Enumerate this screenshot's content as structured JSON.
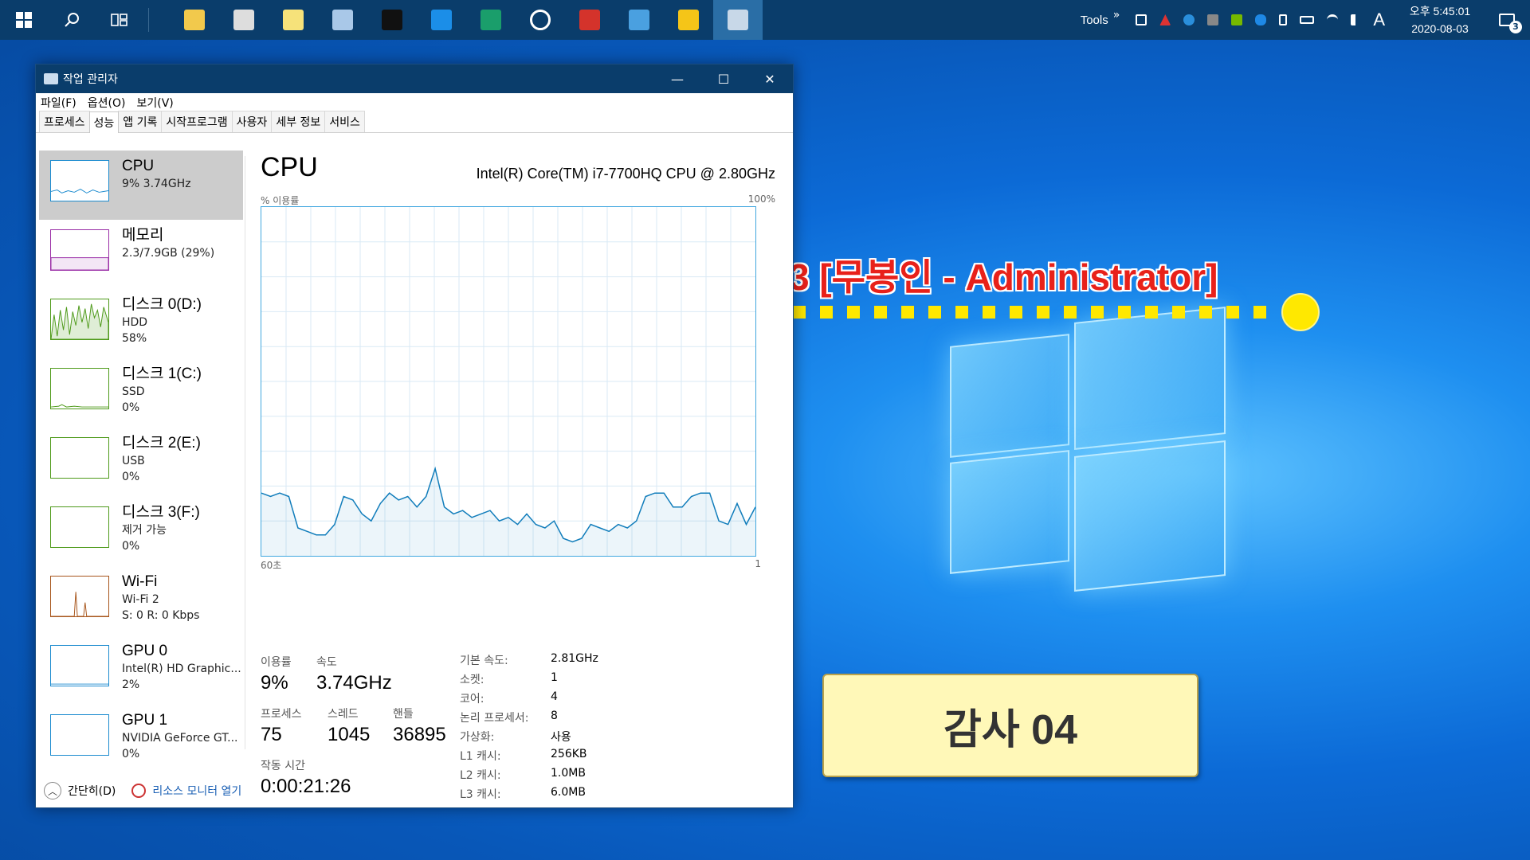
{
  "taskbar": {
    "start_icon": "windows-logo-icon",
    "search_icon": "search-icon",
    "taskview_icon": "task-view-icon",
    "apps": [
      {
        "name": "file-explorer",
        "color": "#f2c94c"
      },
      {
        "name": "calculator",
        "color": "#dddddd"
      },
      {
        "name": "sticky-notes",
        "color": "#f6e27a"
      },
      {
        "name": "app-blue-glass",
        "color": "#a9c8e8"
      },
      {
        "name": "command-prompt",
        "color": "#111111"
      },
      {
        "name": "internet-explorer",
        "color": "#1b8ee8"
      },
      {
        "name": "edge-dev",
        "color": "#1a9e6b"
      },
      {
        "name": "settings",
        "color": "#ffffff"
      },
      {
        "name": "red-green-app",
        "color": "#d4332b"
      },
      {
        "name": "control-panel",
        "color": "#4aa0e0"
      },
      {
        "name": "potplayer",
        "color": "#f5c518"
      },
      {
        "name": "task-manager",
        "color": "#c8d8e8"
      }
    ],
    "tools_label": "Tools",
    "overflow": "»",
    "ime": "A",
    "time": "오후 5:45:01",
    "date": "2020-08-03",
    "notification_count": "3"
  },
  "desktop": {
    "banner": "3 [무봉인  - Administrator]",
    "sticky_note": "감사 04"
  },
  "window": {
    "title": "작업 관리자",
    "minimize": "—",
    "maximize": "☐",
    "close": "✕"
  },
  "menu": [
    "파일(F)",
    "옵션(O)",
    "보기(V)"
  ],
  "tabs": [
    "프로세스",
    "성능",
    "앱 기록",
    "시작프로그램",
    "사용자",
    "세부 정보",
    "서비스"
  ],
  "sidebar": [
    {
      "name": "CPU",
      "lines": [
        "9% 3.74GHz"
      ],
      "color": "#1c8bcf"
    },
    {
      "name": "메모리",
      "lines": [
        "2.3/7.9GB (29%)"
      ],
      "color": "#9a2ea6"
    },
    {
      "name": "디스크 0(D:)",
      "lines": [
        "HDD",
        "58%"
      ],
      "color": "#4e9a1a"
    },
    {
      "name": "디스크 1(C:)",
      "lines": [
        "SSD",
        "0%"
      ],
      "color": "#4e9a1a"
    },
    {
      "name": "디스크 2(E:)",
      "lines": [
        "USB",
        "0%"
      ],
      "color": "#4e9a1a"
    },
    {
      "name": "디스크 3(F:)",
      "lines": [
        "제거 가능",
        "0%"
      ],
      "color": "#4e9a1a"
    },
    {
      "name": "Wi-Fi",
      "lines": [
        "Wi-Fi 2",
        "S: 0 R: 0 Kbps"
      ],
      "color": "#a7551b"
    },
    {
      "name": "GPU 0",
      "lines": [
        "Intel(R) HD Graphic...",
        "2%"
      ],
      "color": "#1c8bcf"
    },
    {
      "name": "GPU 1",
      "lines": [
        "NVIDIA GeForce GT...",
        "0%"
      ],
      "color": "#1c8bcf"
    }
  ],
  "cpu": {
    "title": "CPU",
    "model": "Intel(R) Core(TM) i7-7700HQ CPU @ 2.80GHz",
    "axis_label": "% 이용률",
    "axis_max": "100%",
    "axis_left": "60초",
    "axis_right": "1",
    "utilization_label": "이용률",
    "utilization": "9%",
    "speed_label": "속도",
    "speed": "3.74GHz",
    "processes_label": "프로세스",
    "processes": "75",
    "threads_label": "스레드",
    "threads": "1045",
    "handles_label": "핸들",
    "handles": "36895",
    "uptime_label": "작동 시간",
    "uptime": "0:00:21:26",
    "specs": [
      {
        "k": "기본 속도:",
        "v": "2.81GHz"
      },
      {
        "k": "소켓:",
        "v": "1"
      },
      {
        "k": "코어:",
        "v": "4"
      },
      {
        "k": "논리 프로세서:",
        "v": "8"
      },
      {
        "k": "가상화:",
        "v": "사용"
      },
      {
        "k": "L1 캐시:",
        "v": "256KB"
      },
      {
        "k": "L2 캐시:",
        "v": "1.0MB"
      },
      {
        "k": "L3 캐시:",
        "v": "6.0MB"
      }
    ]
  },
  "chart_data": {
    "type": "area",
    "title": "CPU",
    "xlabel": "",
    "ylabel": "% 이용률",
    "xlim": [
      60,
      1
    ],
    "ylim": [
      0,
      100
    ],
    "grid": true,
    "x": [
      60,
      59,
      58,
      57,
      56,
      55,
      54,
      53,
      52,
      51,
      50,
      49,
      48,
      47,
      46,
      45,
      44,
      43,
      42,
      41,
      40,
      39,
      38,
      37,
      36,
      35,
      34,
      33,
      32,
      31,
      30,
      29,
      28,
      27,
      26,
      25,
      24,
      23,
      22,
      21,
      20,
      19,
      18,
      17,
      16,
      15,
      14,
      13,
      12,
      11,
      10,
      9,
      8,
      7,
      6,
      5,
      4,
      3,
      2,
      1
    ],
    "series": [
      {
        "name": "",
        "values": [
          18,
          17,
          18,
          17,
          8,
          7,
          6,
          6,
          9,
          17,
          16,
          12,
          10,
          15,
          18,
          16,
          17,
          14,
          17,
          25,
          14,
          12,
          13,
          11,
          12,
          13,
          10,
          11,
          9,
          12,
          9,
          8,
          10,
          5,
          4,
          5,
          9,
          8,
          7,
          9,
          8,
          10,
          17,
          18,
          18,
          14,
          14,
          17,
          18,
          18,
          10,
          9,
          15,
          9,
          14
        ]
      }
    ]
  },
  "footer": {
    "fewer_details": "간단히(D)",
    "open_resource_monitor": "리소스 모니터 열기"
  }
}
